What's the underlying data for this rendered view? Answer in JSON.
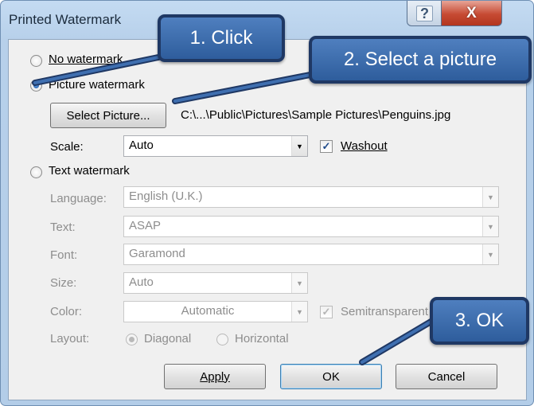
{
  "window": {
    "title": "Printed Watermark",
    "help_glyph": "?",
    "close_glyph": "X"
  },
  "options": {
    "no_watermark": "No watermark",
    "picture_watermark": "Picture watermark",
    "text_watermark": "Text watermark"
  },
  "picture": {
    "select_button": "Select Picture...",
    "path": "C:\\...\\Public\\Pictures\\Sample Pictures\\Penguins.jpg",
    "scale_label": "Scale:",
    "scale_value": "Auto",
    "washout_label": "Washout",
    "washout_checked": true
  },
  "text": {
    "language_label": "Language:",
    "language_value": "English (U.K.)",
    "text_label": "Text:",
    "text_value": "ASAP",
    "font_label": "Font:",
    "font_value": "Garamond",
    "size_label": "Size:",
    "size_value": "Auto",
    "color_label": "Color:",
    "color_value": "Automatic",
    "semitransparent_label": "Semitransparent",
    "layout_label": "Layout:",
    "diagonal_label": "Diagonal",
    "horizontal_label": "Horizontal"
  },
  "buttons": {
    "apply": "Apply",
    "ok": "OK",
    "cancel": "Cancel"
  },
  "callouts": {
    "step1": "1. Click",
    "step2": "2. Select a picture",
    "step3": "3. OK"
  },
  "colors": {
    "callout_fill": "#3f6fb0",
    "callout_border": "#1f3864",
    "title_bar": "#c4dbf2",
    "close_button": "#c64a33"
  }
}
